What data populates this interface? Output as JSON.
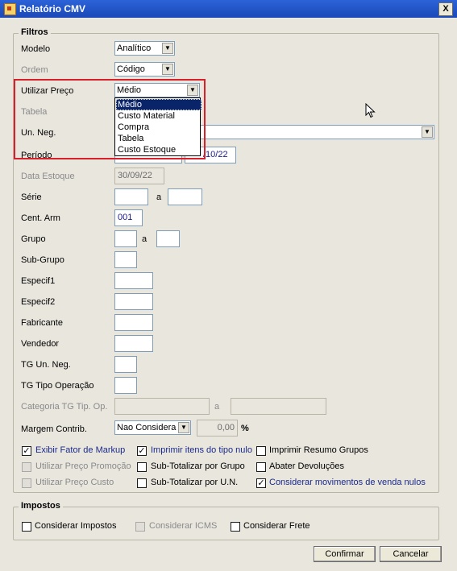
{
  "window": {
    "title": "Relatório CMV",
    "close_glyph": "X"
  },
  "filtros": {
    "legend": "Filtros",
    "modelo": {
      "label": "Modelo",
      "value": "Analítico"
    },
    "ordem": {
      "label": "Ordem",
      "value": "Código"
    },
    "utilizar_preco": {
      "label": "Utilizar Preço",
      "value": "Médio",
      "options": [
        "Médio",
        "Custo Material",
        "Compra",
        "Tabela",
        "Custo Estoque"
      ]
    },
    "tabela": {
      "label": "Tabela"
    },
    "un_neg": {
      "label": "Un. Neg."
    },
    "periodo": {
      "label": "Período",
      "end_partial": "/10/22"
    },
    "data_estoque": {
      "label": "Data Estoque",
      "value": "30/09/22"
    },
    "serie": {
      "label": "Série",
      "sep": "a"
    },
    "cent_arm": {
      "label": "Cent. Arm",
      "value": "001"
    },
    "grupo": {
      "label": "Grupo",
      "sep": "a"
    },
    "sub_grupo": {
      "label": "Sub-Grupo"
    },
    "especif1": {
      "label": "Especif1"
    },
    "especif2": {
      "label": "Especif2"
    },
    "fabricante": {
      "label": "Fabricante"
    },
    "vendedor": {
      "label": "Vendedor"
    },
    "tg_un_neg": {
      "label": "TG Un. Neg."
    },
    "tg_tipo_operacao": {
      "label": "TG Tipo Operação"
    },
    "categoria_tg": {
      "label": "Categoria TG Tip. Op.",
      "sep": "a"
    },
    "margem": {
      "label": "Margem Contrib.",
      "value": "Nao Considera",
      "percent": "0,00",
      "percent_sign": "%"
    }
  },
  "checkboxes": {
    "exibir_fator": {
      "label": "Exibir Fator de Markup",
      "checked": true
    },
    "utilizar_preco_promocao": {
      "label": "Utilizar Preço Promoção",
      "checked": false
    },
    "utilizar_preco_custo": {
      "label": "Utilizar Preço Custo",
      "checked": false
    },
    "imprimir_itens": {
      "label": "Imprimir itens do tipo nulo",
      "checked": true
    },
    "sub_totalizar_grupo": {
      "label": "Sub-Totalizar por Grupo",
      "checked": false
    },
    "sub_totalizar_un": {
      "label": "Sub-Totalizar por U.N.",
      "checked": false
    },
    "imprimir_resumo": {
      "label": "Imprimir Resumo Grupos",
      "checked": false
    },
    "abater_devolucoes": {
      "label": "Abater Devoluções",
      "checked": false
    },
    "considerar_movimentos": {
      "label": "Considerar movimentos de venda nulos",
      "checked": true
    }
  },
  "impostos": {
    "legend": "Impostos",
    "considerar_impostos": {
      "label": "Considerar Impostos",
      "checked": false
    },
    "considerar_icms": {
      "label": "Considerar ICMS",
      "checked": false
    },
    "considerar_frete": {
      "label": "Considerar Frete",
      "checked": false
    }
  },
  "buttons": {
    "confirmar": "Confirmar",
    "cancelar": "Cancelar"
  },
  "check_glyph": "✓",
  "arrow_glyph": "▼"
}
